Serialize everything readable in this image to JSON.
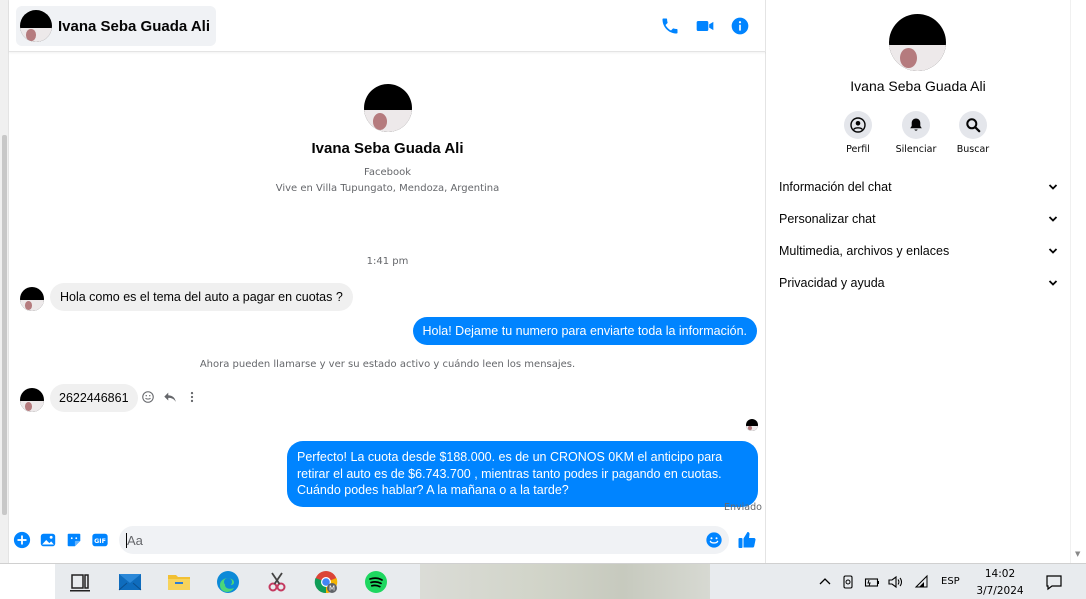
{
  "header": {
    "contact_name": "Ivana Seba Guada Ali",
    "icons": [
      "phone-icon",
      "video-icon",
      "info-icon"
    ]
  },
  "profile": {
    "name": "Ivana Seba Guada Ali",
    "platform": "Facebook",
    "location": "Vive en Villa Tupungato, Mendoza, Argentina"
  },
  "conversation": {
    "time_divider": "1:41 pm",
    "notice": "Ahora pueden llamarse y ver su estado activo y cuándo leen los mensajes.",
    "messages": [
      {
        "direction": "incoming",
        "text": "Hola como es el tema del auto a pagar en cuotas ?"
      },
      {
        "direction": "outgoing",
        "text": "Hola! Dejame tu numero  para enviarte toda la información."
      },
      {
        "direction": "incoming",
        "text": "2622446861"
      },
      {
        "direction": "outgoing",
        "text": "Perfecto! La cuota desde $188.000. es de un CRONOS 0KM el anticipo para retirar el auto es de $6.743.700 , mientras tanto podes ir pagando en cuotas. Cuándo podes hablar? A la mañana o a la tarde?"
      }
    ],
    "sent_status": "Enviado"
  },
  "composer": {
    "placeholder": "Aa",
    "accent_color": "#0084ff"
  },
  "info_panel": {
    "name": "Ivana Seba Guada Ali",
    "actions": [
      {
        "label": "Perfil",
        "icon": "profile-icon"
      },
      {
        "label": "Silenciar",
        "icon": "bell-icon"
      },
      {
        "label": "Buscar",
        "icon": "search-icon"
      }
    ],
    "sections": [
      "Información del chat",
      "Personalizar chat",
      "Multimedia, archivos y enlaces",
      "Privacidad y ayuda"
    ]
  },
  "taskbar": {
    "apps": [
      "task-view-icon",
      "mail-icon",
      "file-explorer-icon",
      "edge-icon",
      "snipping-tool-icon",
      "chrome-icon",
      "spotify-icon"
    ],
    "language": "ESP",
    "time": "14:02",
    "date": "3/7/2024"
  }
}
